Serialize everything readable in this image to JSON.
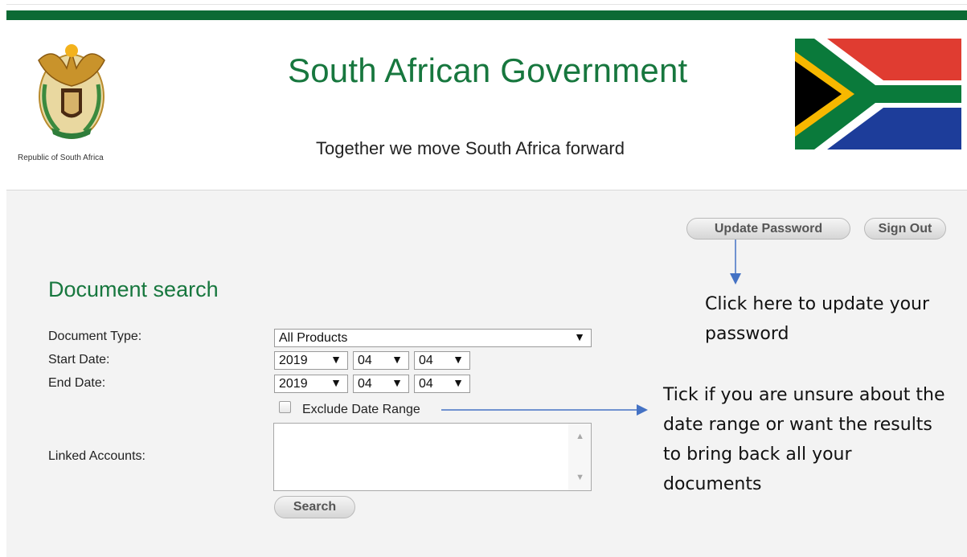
{
  "header": {
    "republic_label": "Republic of South Africa",
    "title": "South African Government",
    "tagline": "Together we move South Africa forward",
    "coat_of_arms_icon": "coat-of-arms-icon",
    "flag_icon": "south-african-flag-icon"
  },
  "account": {
    "update_password_label": "Update Password",
    "sign_out_label": "Sign Out"
  },
  "search_form": {
    "title": "Document search",
    "document_type_label": "Document Type:",
    "document_type_value": "All Products",
    "start_date_label": "Start Date:",
    "start_year": "2019",
    "start_month": "04",
    "start_day": "04",
    "end_date_label": "End Date:",
    "end_year": "2019",
    "end_month": "04",
    "end_day": "04",
    "exclude_date_range_label": "Exclude Date Range",
    "linked_accounts_label": "Linked Accounts:",
    "search_label": "Search",
    "dropdown_arrow": "▼"
  },
  "annotations": {
    "update_password_note": "Click here to update your password",
    "exclude_date_note": "Tick if you are unsure about the date range or want the results to bring back all your documents"
  },
  "colors": {
    "brand_green": "#0d6a34",
    "title_green": "#17773e",
    "panel_background": "#f3f3f3",
    "arrow_blue": "#4472c4"
  }
}
